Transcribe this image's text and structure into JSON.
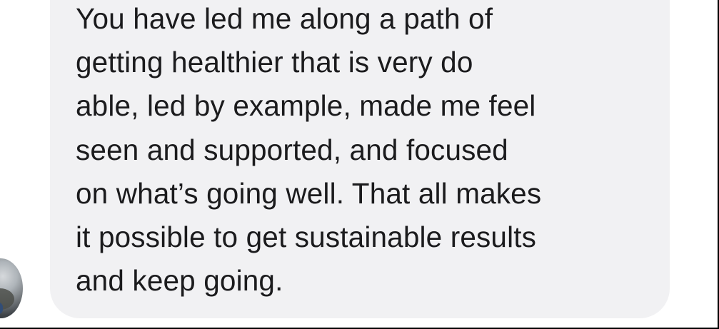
{
  "message": {
    "lines": [
      "You have led me along a path of",
      "getting healthier that is very do",
      "able, led by example, made me feel",
      "seen and supported, and focused",
      "on what’s going well. That all makes",
      "it possible to get sustainable results",
      "and keep going."
    ]
  },
  "colors": {
    "bubble": "#f1f1f3",
    "text": "#1b1b1d",
    "background": "#ffffff"
  }
}
